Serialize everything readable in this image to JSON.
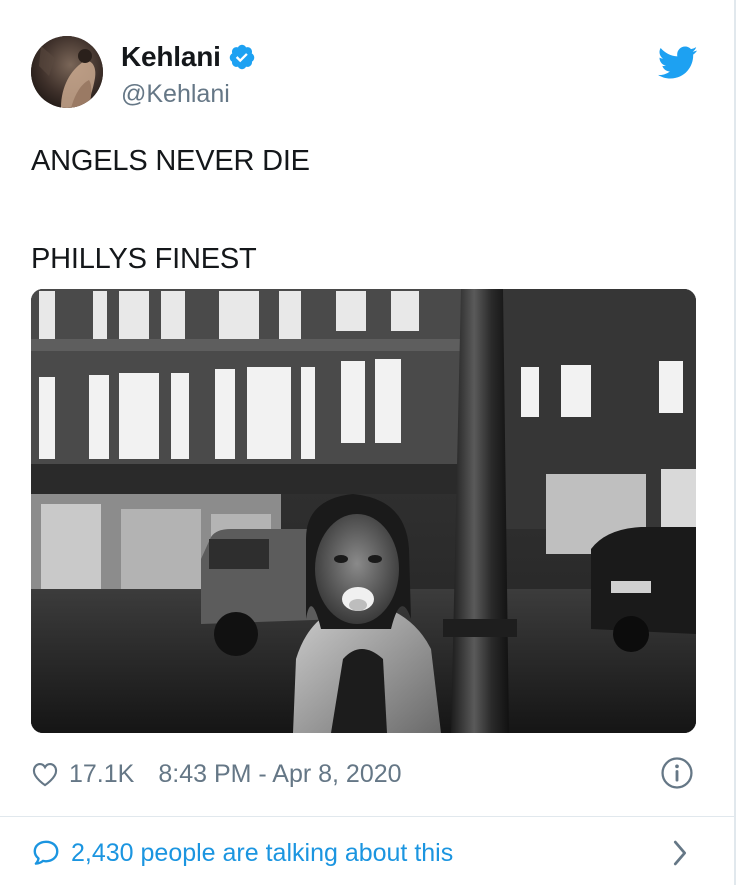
{
  "tweet": {
    "author_name": "Kehlani",
    "author_handle": "@Kehlani",
    "verified": true,
    "text_lines": [
      "ANGELS NEVER DIE",
      "PHILLYS FINEST"
    ],
    "like_count": "17.1K",
    "timestamp": "8:43 PM - Apr 8, 2020",
    "conversation_text": "2,430 people are talking about this"
  },
  "icons": {
    "verified": "verified-badge-icon",
    "bird": "twitter-bird-icon",
    "heart": "heart-icon",
    "info": "info-icon",
    "bubble": "speech-bubble-icon",
    "chevron": "chevron-right-icon"
  },
  "colors": {
    "brand_blue": "#1da1f2",
    "link_blue": "#1b95e0",
    "secondary_text": "#657786",
    "primary_text": "#14171a",
    "divider": "#e1e8ed"
  }
}
